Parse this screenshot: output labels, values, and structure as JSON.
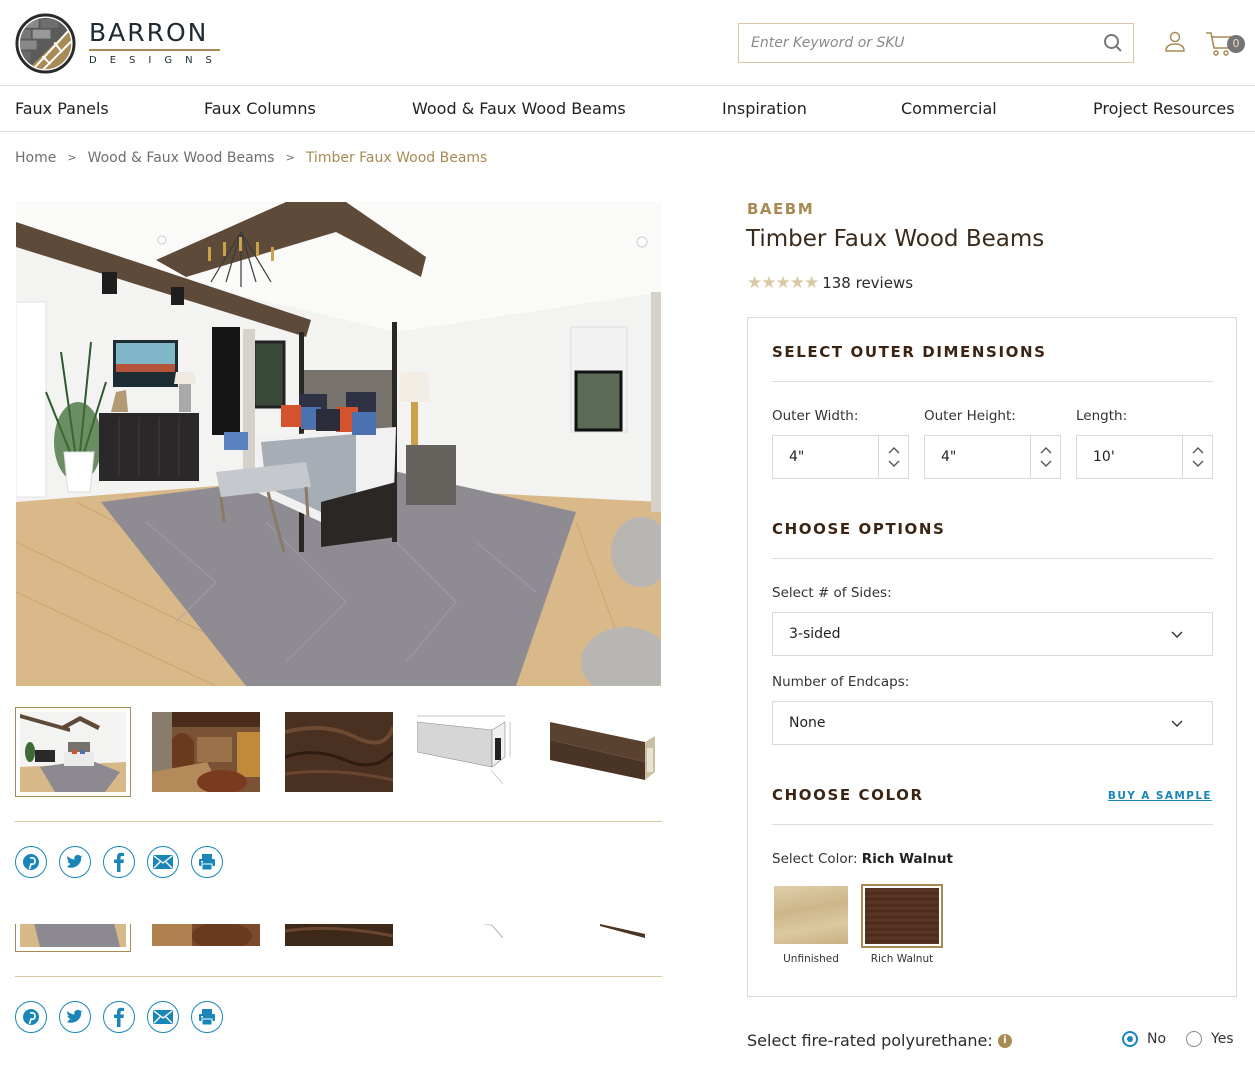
{
  "brand": {
    "name": "BARRON",
    "subtitle": "DESIGNS",
    "accent_color": "#a88a55",
    "link_color": "#1a86b8"
  },
  "header": {
    "search_placeholder": "Enter Keyword or SKU",
    "search_icon": "search-icon",
    "account_icon": "user-icon",
    "cart_icon": "cart-icon",
    "cart_count": "0"
  },
  "nav": {
    "items": [
      {
        "label": "Faux Panels"
      },
      {
        "label": "Faux Columns"
      },
      {
        "label": "Wood & Faux Wood Beams"
      },
      {
        "label": "Inspiration"
      },
      {
        "label": "Commercial"
      },
      {
        "label": "Project Resources"
      }
    ]
  },
  "breadcrumb": {
    "separator": ">",
    "items": [
      {
        "label": "Home"
      },
      {
        "label": "Wood & Faux Wood Beams"
      },
      {
        "label": "Timber Faux Wood Beams"
      }
    ]
  },
  "gallery": {
    "main_image": "bedroom-with-faux-wood-ceiling-beams",
    "thumbnails": [
      {
        "name": "bedroom-photo",
        "active": true
      },
      {
        "name": "wine-room-photo",
        "active": false
      },
      {
        "name": "wood-texture-closeup",
        "active": false
      },
      {
        "name": "dimension-diagram",
        "active": false
      },
      {
        "name": "beam-product-shot",
        "active": false
      }
    ],
    "share_icons": [
      "pinterest-icon",
      "twitter-icon",
      "facebook-icon",
      "email-icon",
      "print-icon"
    ]
  },
  "product": {
    "sku": "BAEBM",
    "title": "Timber Faux Wood Beams",
    "rating": 5,
    "rating_max": 5,
    "reviews_label": "138 reviews"
  },
  "config": {
    "dimensions": {
      "title": "SELECT OUTER DIMENSIONS",
      "fields": [
        {
          "label": "Outer Width:",
          "value": "4\""
        },
        {
          "label": "Outer Height:",
          "value": "4\""
        },
        {
          "label": "Length:",
          "value": "10'"
        }
      ]
    },
    "options": {
      "title": "CHOOSE OPTIONS",
      "sides_label": "Select # of Sides:",
      "sides_value": "3-sided",
      "endcaps_label": "Number of Endcaps:",
      "endcaps_value": "None"
    },
    "color": {
      "title": "CHOOSE COLOR",
      "buy_sample": "BUY A SAMPLE",
      "select_label": "Select Color:",
      "selected": "Rich Walnut",
      "swatches": [
        {
          "name": "Unfinished",
          "color": "#d8c49c",
          "selected": false
        },
        {
          "name": "Rich Walnut",
          "color": "#5a3626",
          "selected": true
        }
      ]
    }
  },
  "fire_rated": {
    "label": "Select fire-rated polyurethane:",
    "info_icon": "i",
    "options": [
      {
        "label": "No",
        "checked": true
      },
      {
        "label": "Yes",
        "checked": false
      }
    ]
  }
}
